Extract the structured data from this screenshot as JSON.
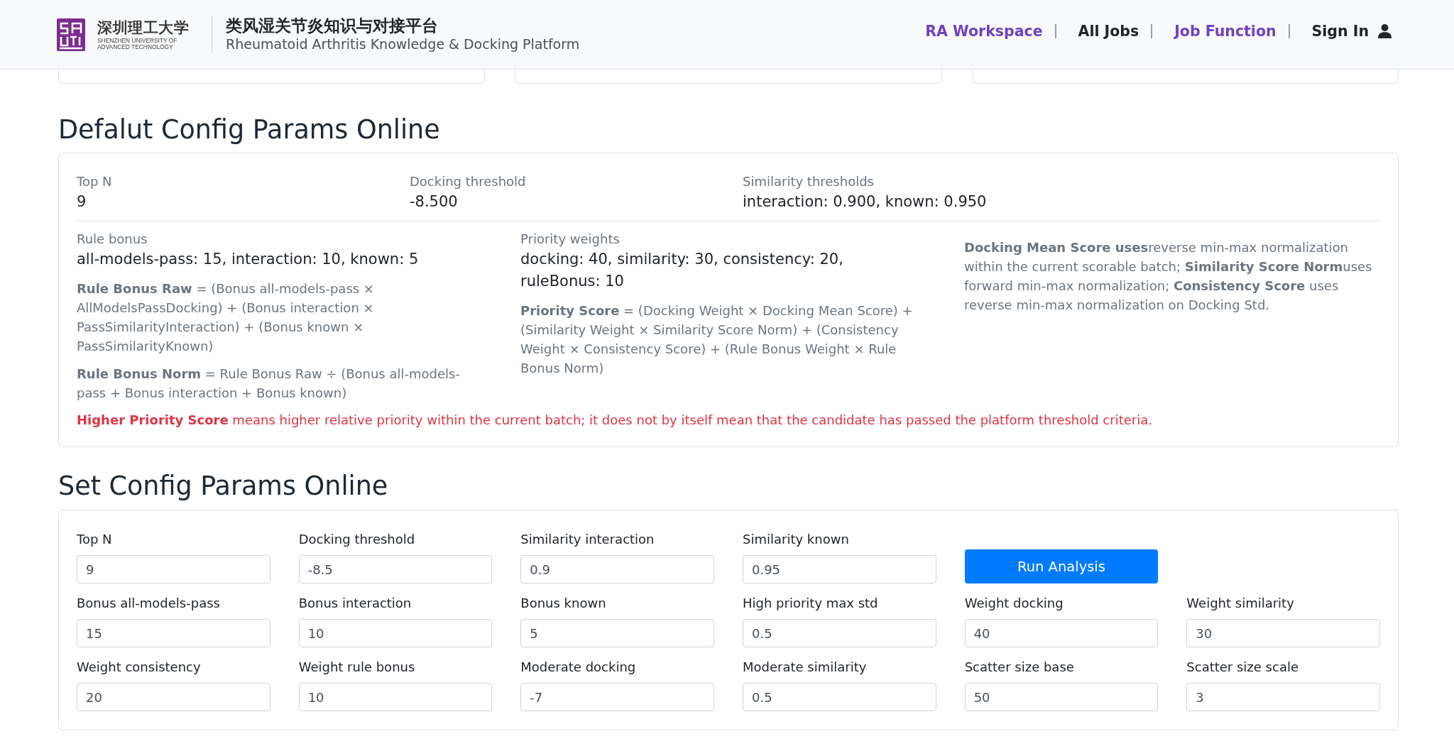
{
  "header": {
    "logo": {
      "name_cn": "深圳理工大学",
      "name_en": [
        "SHENZHEN UNIVERSITY OF",
        "ADVANCED TECHNOLOGY"
      ]
    },
    "title": "类风湿关节炎知识与对接平台",
    "subtitle": "Rheumatoid Arthritis Knowledge & Docking Platform",
    "nav": [
      {
        "label": "RA Workspace",
        "kind": "link",
        "color": "#6f42c1"
      },
      {
        "label": "All Jobs",
        "kind": "link",
        "color": "#212529"
      },
      {
        "label": "Job Function",
        "kind": "link",
        "color": "#6f42c1"
      },
      {
        "label": "Sign In",
        "kind": "account",
        "color": "#212529"
      }
    ]
  },
  "default_config": {
    "title": "Defalut Config Params Online",
    "summary": [
      {
        "label": "Top N",
        "value": "9"
      },
      {
        "label": "Docking threshold",
        "value": "-8.500"
      },
      {
        "label": "Similarity thresholds",
        "value": "interaction: 0.900, known: 0.950"
      }
    ],
    "details": [
      {
        "label": "Rule bonus",
        "value": "all-models-pass: 15, interaction: 10, known: 5",
        "notes": [
          "**Rule Bonus Raw** = (Bonus all-models-pass × AllModelsPassDocking) + (Bonus interaction × PassSimilarityInteraction) + (Bonus known × PassSimilarityKnown)",
          "**Rule Bonus Norm** = Rule Bonus Raw ÷ (Bonus all-models-pass + Bonus interaction + Bonus known)"
        ]
      },
      {
        "label": "Priority weights",
        "value": "docking: 40, similarity: 30, consistency: 20, ruleBonus: 10",
        "notes": [
          "**Priority Score** = (Docking Weight × Docking Mean Score) + (Similarity Weight × Similarity Score Norm) + (Consistency Weight × Consistency Score) + (Rule Bonus Weight × Rule Bonus Norm)"
        ]
      }
    ],
    "explanation": "**Docking Mean Score uses**reverse min-max normalization within the current scorable batch; **Similarity Score Norm**uses forward min-max normalization; **Consistency Score** uses reverse min-max normalization on Docking Std.",
    "warning": "**Higher Priority Score** means higher relative priority within the current batch; it does not by itself mean that the candidate has passed the platform threshold criteria."
  },
  "set_config": {
    "title": "Set Config Params Online",
    "rows": [
      [
        {
          "kind": "input",
          "label": "Top N",
          "value": "9"
        },
        {
          "kind": "input",
          "label": "Docking threshold",
          "value": "-8.5"
        },
        {
          "kind": "input",
          "label": "Similarity interaction",
          "value": "0.9"
        },
        {
          "kind": "input",
          "label": "Similarity known",
          "value": "0.95"
        },
        {
          "kind": "button",
          "label": "Run Analysis"
        }
      ],
      [
        {
          "kind": "input",
          "label": "Bonus all-models-pass",
          "value": "15"
        },
        {
          "kind": "input",
          "label": "Bonus interaction",
          "value": "10"
        },
        {
          "kind": "input",
          "label": "Bonus known",
          "value": "5"
        },
        {
          "kind": "input",
          "label": "High priority max std",
          "value": "0.5"
        },
        {
          "kind": "input",
          "label": "Weight docking",
          "value": "40"
        },
        {
          "kind": "input",
          "label": "Weight similarity",
          "value": "30"
        }
      ],
      [
        {
          "kind": "input",
          "label": "Weight consistency",
          "value": "20"
        },
        {
          "kind": "input",
          "label": "Weight rule bonus",
          "value": "10"
        },
        {
          "kind": "input",
          "label": "Moderate docking",
          "value": "-7"
        },
        {
          "kind": "input",
          "label": "Moderate similarity",
          "value": "0.5"
        },
        {
          "kind": "input",
          "label": "Scatter size base",
          "value": "50"
        },
        {
          "kind": "input",
          "label": "Scatter size scale",
          "value": "3"
        }
      ]
    ]
  }
}
